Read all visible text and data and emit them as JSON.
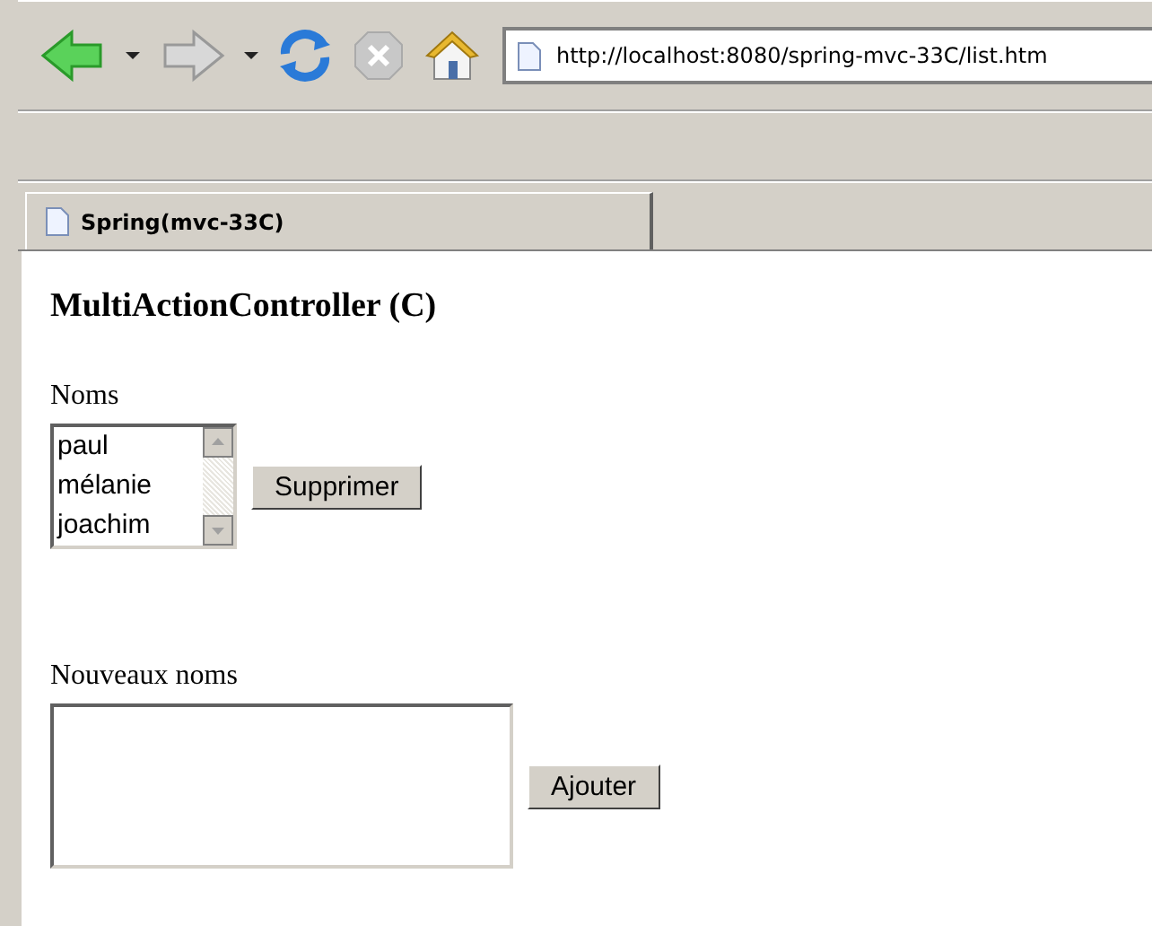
{
  "toolbar": {
    "address": "http://localhost:8080/spring-mvc-33C/list.htm"
  },
  "tabs": [
    {
      "label": "Spring(mvc-33C)",
      "selected": true
    }
  ],
  "page": {
    "heading": "MultiActionController (C)",
    "list_label": "Noms",
    "names": [
      {
        "label": "paul",
        "selected": false
      },
      {
        "label": "mélanie",
        "selected": false
      },
      {
        "label": "joachim",
        "selected": false
      }
    ],
    "delete_button": "Supprimer",
    "new_label": "Nouveaux noms",
    "add_button": "Ajouter"
  }
}
